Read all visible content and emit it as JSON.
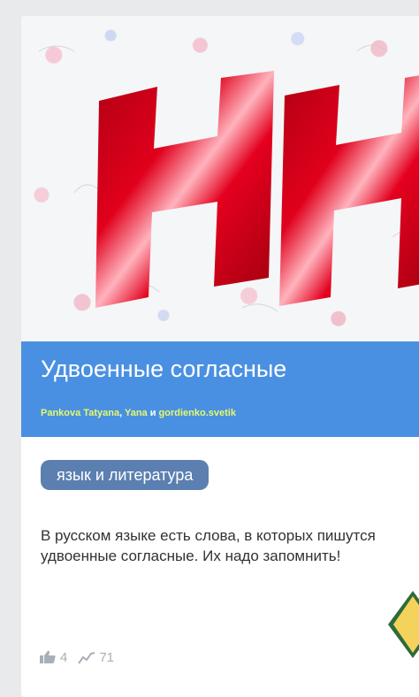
{
  "cover": {
    "icon": "cover-image",
    "letters": "НН",
    "letter_color": "#d8001a",
    "background": "floral-pattern"
  },
  "card": {
    "title": "Удвоенные согласные",
    "authors": [
      {
        "name": "Pankova Tatyana"
      },
      {
        "name": "Yana"
      },
      {
        "name": "gordienko.svetik"
      }
    ],
    "authors_sep_comma": ", ",
    "authors_sep_and": " и ",
    "tag": "язык и литература",
    "description": "В русском языке есть слова, в которых пишутся удвоенные согласные. Их надо запомнить!"
  },
  "stats": {
    "likes": "4",
    "likes_icon": "thumbs-up-icon",
    "views": "71",
    "views_icon": "trend-icon"
  },
  "colors": {
    "title_bar": "#4a90e2",
    "tag_bg": "#5b7fb0",
    "author_link": "#e6f96a"
  }
}
